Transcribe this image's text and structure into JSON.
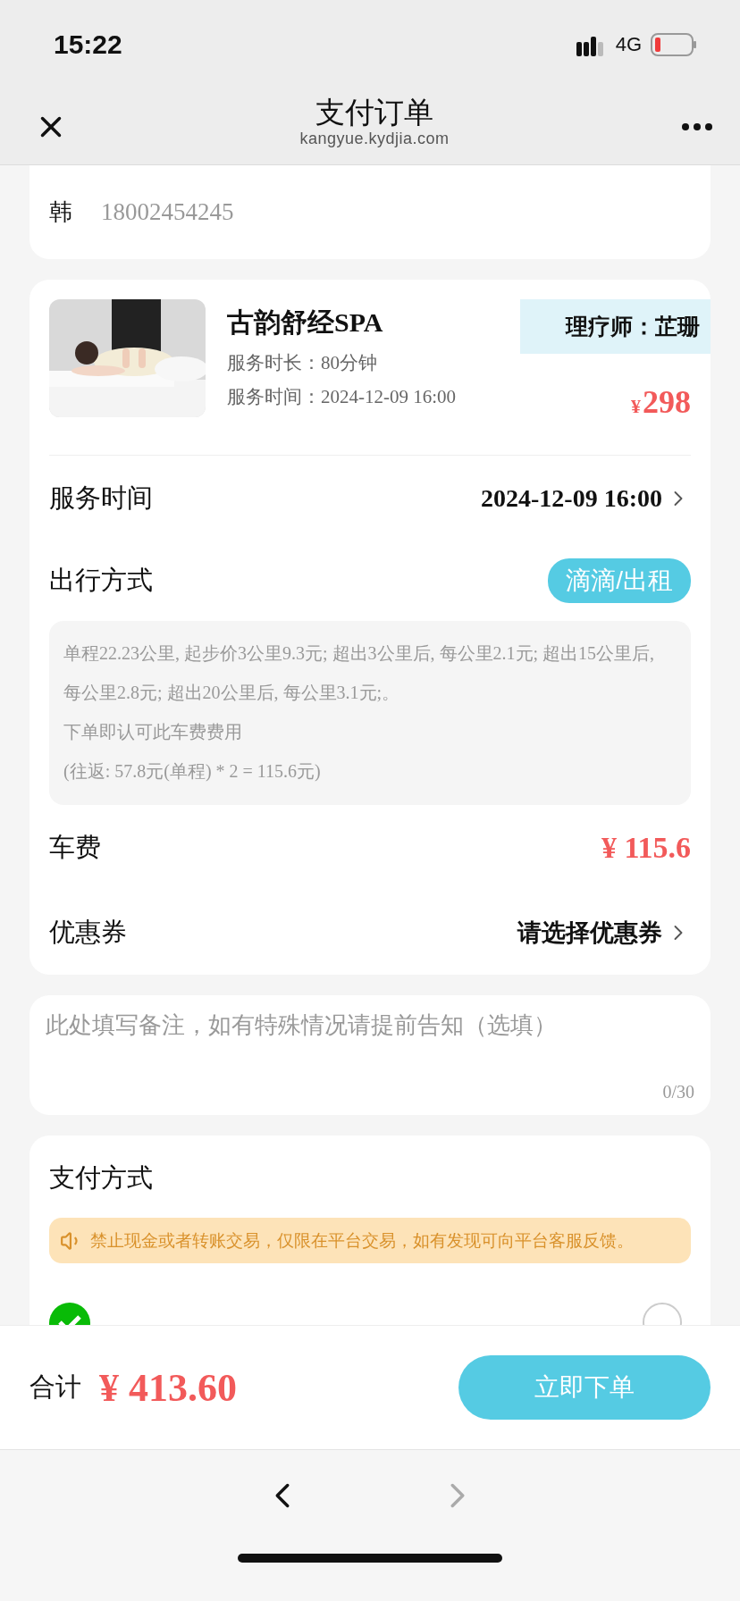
{
  "status_bar": {
    "time": "15:22",
    "network": "4G"
  },
  "nav": {
    "title": "支付订单",
    "url": "kangyue.kydjia.com"
  },
  "contact": {
    "name": "韩",
    "phone": "18002454245"
  },
  "service": {
    "name": "古韵舒经SPA",
    "therapist": "理疗师：芷珊",
    "details": [
      {
        "label": "服务时长：",
        "value": "80分钟"
      },
      {
        "label": "服务时间：",
        "value": "2024-12-09 16:00"
      }
    ],
    "currency": "¥",
    "price": "298"
  },
  "order_rows": [
    {
      "kind": "link",
      "label": "服务时间",
      "value": "2024-12-09 16:00"
    },
    {
      "kind": "tag",
      "label": "出行方式",
      "value": "滴滴/出租"
    },
    {
      "kind": "note",
      "lines": [
        "单程22.23公里, 起步价3公里9.3元; 超出3公里后, 每公里2.1元; 超出15公里后, 每公里2.8元; 超出20公里后, 每公里3.1元;。",
        "下单即认可此车费费用",
        "(往返: 57.8元(单程) * 2 = 115.6元)"
      ]
    },
    {
      "kind": "price",
      "label": "车费",
      "value": "¥ 115.6"
    },
    {
      "kind": "link",
      "label": "优惠券",
      "value": "请选择优惠券"
    }
  ],
  "remark": {
    "placeholder": "此处填写备注，如有特殊情况请提前告知（选填）",
    "counter": "0/30"
  },
  "payment": {
    "title": "支付方式",
    "notice": "禁止现金或者转账交易，仅限在平台交易，如有发现可向平台客服反馈。",
    "options": [
      {
        "selected": false
      }
    ]
  },
  "footer": {
    "total_label": "合计",
    "total": "¥ 413.60",
    "submit": "立即下单"
  },
  "browser_toolbar": [
    {
      "kind": "back",
      "disabled": false
    },
    {
      "kind": "forward",
      "disabled": true
    }
  ]
}
